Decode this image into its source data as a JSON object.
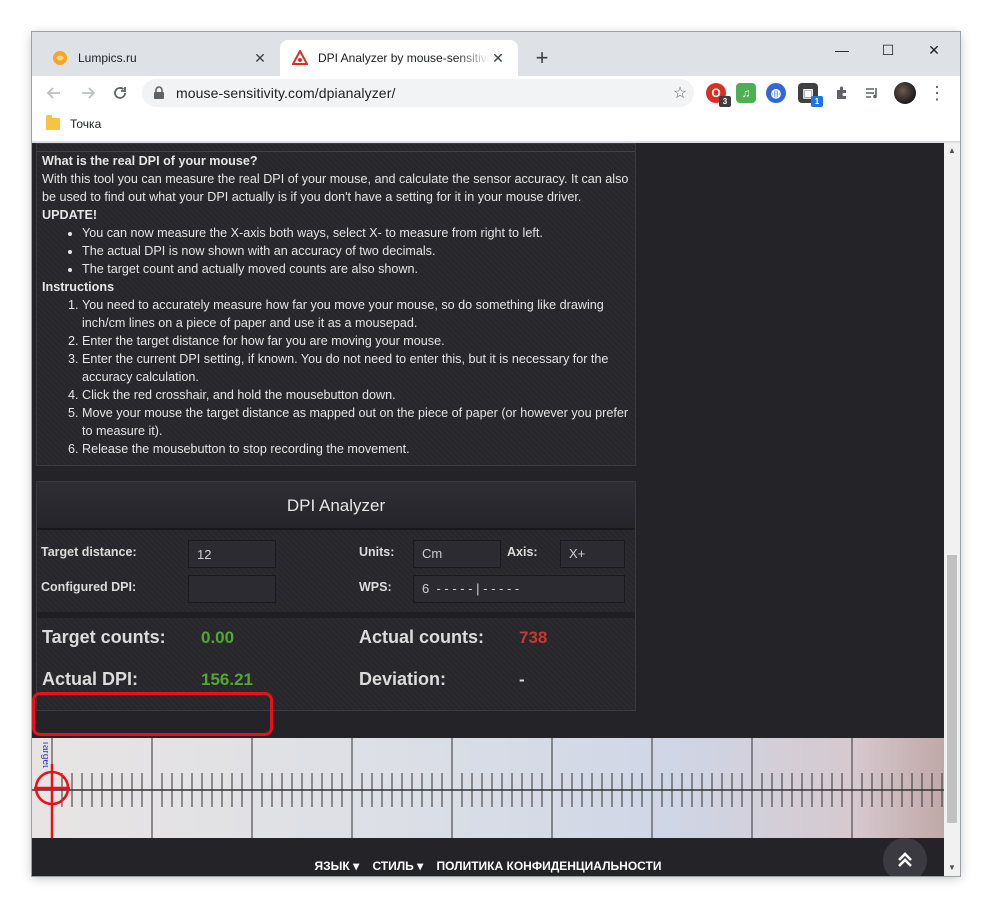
{
  "tabs": [
    {
      "title": "Lumpics.ru",
      "active": false
    },
    {
      "title": "DPI Analyzer by mouse-sensitivity.com",
      "active": true
    }
  ],
  "window_controls": {
    "minimize": "—",
    "maximize": "☐",
    "close": "✕"
  },
  "toolbar": {
    "url": "mouse-sensitivity.com/dpianalyzer/",
    "extensions": [
      {
        "icon": "opera-icon",
        "badge": "3",
        "color": "#d93025"
      },
      {
        "icon": "music-icon",
        "badge": "",
        "color": "#4caf50"
      },
      {
        "icon": "globe-icon",
        "badge": "",
        "color": "#3367d6"
      },
      {
        "icon": "cube-icon",
        "badge": "1",
        "color": "#3c4043"
      }
    ]
  },
  "bookmarks": [
    {
      "label": "Точка"
    }
  ],
  "info": {
    "heading": "What is the real DPI of your mouse?",
    "intro": "With this tool you can measure the real DPI of your mouse, and calculate the sensor accuracy. It can also be used to find out what your DPI actually is if you don't have a setting for it in your mouse driver.",
    "update_heading": "UPDATE!",
    "updates": [
      "You can now measure the X-axis both ways, select X- to measure from right to left.",
      "The actual DPI is now shown with an accuracy of two decimals.",
      "The target count and actually moved counts are also shown."
    ],
    "instructions_heading": "Instructions",
    "instructions": [
      "You need to accurately measure how far you move your mouse, so do something like drawing inch/cm lines on a piece of paper and use it as a mousepad.",
      "Enter the target distance for how far you are moving your mouse.",
      "Enter the current DPI setting, if known. You do not need to enter this, but it is necessary for the accuracy calculation.",
      "Click the red crosshair, and hold the mousebutton down.",
      "Move your mouse the target distance as mapped out on the piece of paper (or however you prefer to measure it).",
      "Release the mousebutton to stop recording the movement."
    ]
  },
  "analyzer": {
    "title": "DPI Analyzer",
    "target_distance_label": "Target distance:",
    "target_distance_value": "12",
    "units_label": "Units:",
    "units_value": "Cm",
    "axis_label": "Axis:",
    "axis_value": "X+",
    "configured_dpi_label": "Configured DPI:",
    "configured_dpi_value": "",
    "wps_label": "WPS:",
    "wps_value": "6  - - - - - | - - - - -",
    "target_counts_label": "Target counts:",
    "target_counts_value": "0.00",
    "actual_counts_label": "Actual counts:",
    "actual_counts_value": "738",
    "actual_dpi_label": "Actual DPI:",
    "actual_dpi_value": "156.21",
    "deviation_label": "Deviation:",
    "deviation_value": "-"
  },
  "ruler": {
    "target_label": "Target"
  },
  "footer": {
    "language": "ЯЗЫК ▾",
    "style": "СТИЛЬ ▾",
    "privacy": "ПОЛИТИКА КОНФИДЕНЦИАЛЬНОСТИ"
  },
  "colors": {
    "accent_red": "#e8101a",
    "value_green": "#52a830",
    "value_red": "#c8392f"
  }
}
